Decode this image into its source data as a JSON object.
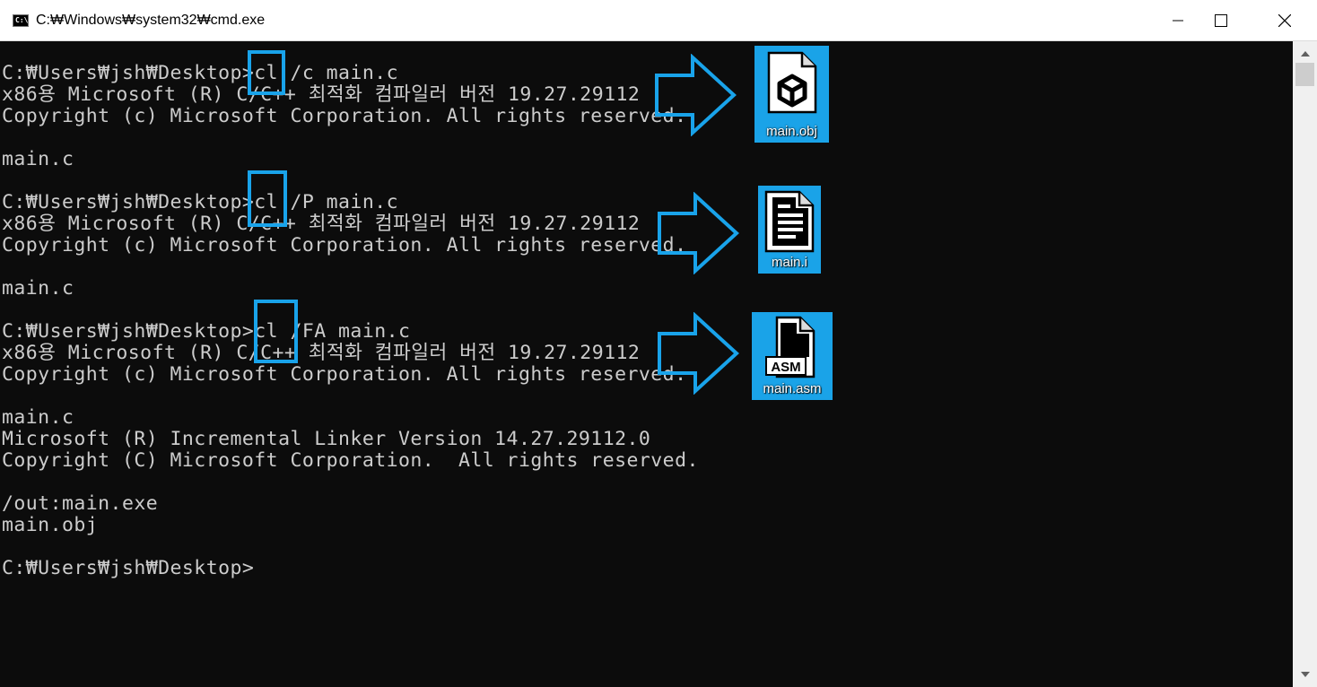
{
  "window": {
    "title": "C:₩Windows₩system32₩cmd.exe",
    "icon": "console-icon",
    "icon_text": "C:\\",
    "controls": [
      "minimize-icon",
      "maximize-icon",
      "close-icon"
    ]
  },
  "terminal": {
    "lines": [
      "C:₩Users₩jsh₩Desktop>cl /c main.c",
      "x86용 Microsoft (R) C/C++ 최적화 컴파일러 버전 19.27.29112",
      "Copyright (c) Microsoft Corporation. All rights reserved.",
      "",
      "main.c",
      "",
      "C:₩Users₩jsh₩Desktop>cl /P main.c",
      "x86용 Microsoft (R) C/C++ 최적화 컴파일러 버전 19.27.29112",
      "Copyright (c) Microsoft Corporation. All rights reserved.",
      "",
      "main.c",
      "",
      "C:₩Users₩jsh₩Desktop>cl /FA main.c",
      "x86용 Microsoft (R) C/C++ 최적화 컴파일러 버전 19.27.29112",
      "Copyright (c) Microsoft Corporation. All rights reserved.",
      "",
      "main.c",
      "Microsoft (R) Incremental Linker Version 14.27.29112.0",
      "Copyright (C) Microsoft Corporation.  All rights reserved.",
      "",
      "/out:main.exe",
      "main.obj",
      "",
      "C:₩Users₩jsh₩Desktop>"
    ]
  },
  "annotations": {
    "highlight_color": "#19a3ea",
    "files": [
      {
        "label": "main.obj",
        "icon": "object-file-icon"
      },
      {
        "label": "main.i",
        "icon": "text-file-icon"
      },
      {
        "label": "main.asm",
        "icon": "asm-file-icon",
        "badge": "ASM"
      }
    ]
  },
  "colors": {
    "terminal_bg": "#0c0c0c",
    "terminal_fg": "#cccccc",
    "accent": "#1aa3e8"
  }
}
